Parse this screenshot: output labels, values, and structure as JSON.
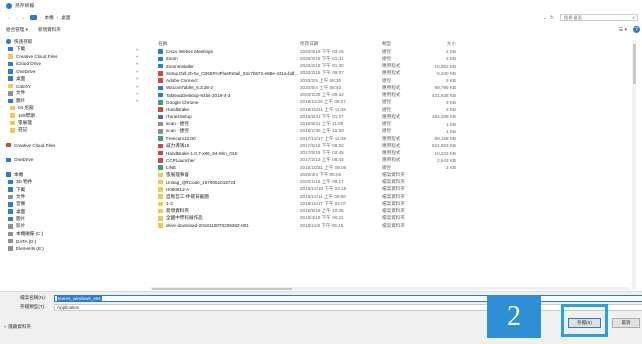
{
  "window": {
    "title": "另存新檔"
  },
  "address": {
    "crumbs": [
      "本機",
      "桌面"
    ],
    "search_placeholder": "搜尋 桌面"
  },
  "toolbar": {
    "organize": "組合管理 ▾",
    "new_folder": "新增資料夾"
  },
  "nav": [
    {
      "label": "快速存取",
      "icon": "star-icon",
      "color": "star",
      "pinned": false
    },
    {
      "label": "下載",
      "icon": "download-icon",
      "color": "blue",
      "pinned": true
    },
    {
      "label": "Creative Cloud Files",
      "icon": "folder-icon",
      "color": "yellow",
      "pinned": true
    },
    {
      "label": "iCloud Drive",
      "icon": "cloud-icon",
      "color": "blue",
      "pinned": true
    },
    {
      "label": "OneDrive",
      "icon": "cloud-icon",
      "color": "blue",
      "pinned": true
    },
    {
      "label": "桌面",
      "icon": "desktop-icon",
      "color": "blue",
      "pinned": true
    },
    {
      "label": "CatchY",
      "icon": "folder-icon",
      "color": "yellow",
      "pinned": true
    },
    {
      "label": "文件",
      "icon": "document-icon",
      "color": "gray",
      "pinned": true
    },
    {
      "label": "圖片",
      "icon": "picture-icon",
      "color": "blue",
      "pinned": true
    },
    {
      "label": "04.尼龍",
      "icon": "folder-icon",
      "color": "yellow",
      "pinned": false
    },
    {
      "label": "109學期",
      "icon": "folder-icon",
      "color": "yellow",
      "pinned": false
    },
    {
      "label": "張展理",
      "icon": "folder-icon",
      "color": "yellow",
      "pinned": false
    },
    {
      "label": "週記",
      "icon": "folder-icon",
      "color": "yellow",
      "pinned": false
    },
    {
      "label": "",
      "icon": "",
      "color": "",
      "pinned": false
    },
    {
      "label": "Creative Cloud Files",
      "icon": "cloud-icon",
      "color": "red",
      "pinned": false
    },
    {
      "label": "",
      "icon": "",
      "color": "",
      "pinned": false
    },
    {
      "label": "OneDrive",
      "icon": "cloud-icon",
      "color": "blue",
      "pinned": false
    },
    {
      "label": "",
      "icon": "",
      "color": "",
      "pinned": false
    },
    {
      "label": "本機",
      "icon": "computer-icon",
      "color": "blue",
      "pinned": false
    },
    {
      "label": "3D 物件",
      "icon": "cube-icon",
      "color": "blue",
      "pinned": false
    },
    {
      "label": "下載",
      "icon": "download-icon",
      "color": "blue",
      "pinned": false
    },
    {
      "label": "文件",
      "icon": "document-icon",
      "color": "gray",
      "pinned": false
    },
    {
      "label": "音樂",
      "icon": "music-icon",
      "color": "blue",
      "pinned": false
    },
    {
      "label": "桌面",
      "icon": "desktop-icon",
      "color": "blue",
      "pinned": false
    },
    {
      "label": "圖片",
      "icon": "picture-icon",
      "color": "blue",
      "pinned": false
    },
    {
      "label": "影片",
      "icon": "video-icon",
      "color": "gray",
      "pinned": false
    },
    {
      "label": "本機磁碟 (C:)",
      "icon": "drive-icon",
      "color": "gray",
      "pinned": false
    },
    {
      "label": "DATA (D:)",
      "icon": "drive-icon",
      "color": "gray",
      "pinned": false
    },
    {
      "label": "Elements (E:)",
      "icon": "drive-icon",
      "color": "gray",
      "pinned": false
    }
  ],
  "columns": [
    "名稱",
    "修改日期",
    "類型",
    "大小"
  ],
  "files": [
    {
      "name": "Cisco Webex Meetings",
      "date": "2020/3/18 下午 03:15",
      "type": "捷徑",
      "size": "2 KB",
      "color": "blue"
    },
    {
      "name": "Zoom",
      "date": "2020/3/18 下午 01:31",
      "type": "捷徑",
      "size": "2 KB",
      "color": "blue"
    },
    {
      "name": "ZoomInstaller",
      "date": "2020/3/18 下午 01:30",
      "type": "應用程式",
      "size": "10,952 KB",
      "color": "blue"
    },
    {
      "name": "Setup.Def.zh-tw_O365ProPlusRetail_04c7b572-e88e-431a-bdf...",
      "date": "2020/2/18 下午 09:07",
      "type": "應用程式",
      "size": "5,340 KB",
      "color": "red"
    },
    {
      "name": "Adobe Connect",
      "date": "2020/2/5 上午 08:30",
      "type": "捷徑",
      "size": "2 KB",
      "color": "red"
    },
    {
      "name": "WacomTablet_6.3.38-2",
      "date": "2020/5/4 上午 08:40",
      "type": "應用程式",
      "size": "99,799 KB",
      "color": "blue"
    },
    {
      "name": "TableauDesktop-64bit-2019-4-3",
      "date": "2020/2/25 上午 09:42",
      "type": "應用程式",
      "size": "421,928 KB",
      "color": "blue"
    },
    {
      "name": "Google Chrome",
      "date": "2019/11/20 上午 09:27",
      "type": "捷徑",
      "size": "3 KB",
      "color": "green"
    },
    {
      "name": "HandBrake",
      "date": "2019/10/21 上午 11:46",
      "type": "捷徑",
      "size": "2 KB",
      "color": "red"
    },
    {
      "name": "iTunesSetup",
      "date": "2019/5/31 下午 01:27",
      "type": "應用程式",
      "size": "282,409 KB",
      "color": "blue"
    },
    {
      "name": "scan - 捷徑",
      "date": "2019/5/31 上午 11:06",
      "type": "捷徑",
      "size": "1 KB",
      "color": "gray"
    },
    {
      "name": "scan - 捷徑",
      "date": "2019/1/30 上午 10:59",
      "type": "捷徑",
      "size": "1 KB",
      "color": "gray"
    },
    {
      "name": "Freecam12.00",
      "date": "2017/12/17 上午 11:48",
      "type": "應用程式",
      "size": "89,168 KB",
      "color": "green"
    },
    {
      "name": "威力導演16",
      "date": "2017/6/16 下午 06:02",
      "type": "應用程式",
      "size": "624,903 KB",
      "color": "red"
    },
    {
      "name": "HandBrake-1.0.7-x86_64-Win_GUI",
      "date": "2017/5/18 下午 02:45",
      "type": "應用程式",
      "size": "10,223 KB",
      "color": "red"
    },
    {
      "name": "CCPLauncher",
      "date": "2017/2/13 上午 08:44",
      "type": "應用程式",
      "size": "2,643 KB",
      "color": "red"
    },
    {
      "name": "LINE",
      "date": "2016/10/21 上午 08:06",
      "type": "捷徑",
      "size": "2 KB",
      "color": "green"
    },
    {
      "name": "張展理事會",
      "date": "2020/3/4 下午 05:00",
      "type": "檔案資料夾",
      "size": "",
      "color": "yellow"
    },
    {
      "name": "Unitag_QRCode_1579051018723",
      "date": "2020/1/15 上午 09:17",
      "type": "檔案資料夾",
      "size": "",
      "color": "yellow"
    },
    {
      "name": "H080812-A",
      "date": "2019/12/18 下午 03:15",
      "type": "檔案資料夾",
      "size": "",
      "color": "yellow"
    },
    {
      "name": "自製互工-件碳背截圖",
      "date": "2019/12/11 上午 09:50",
      "type": "檔案資料夾",
      "size": "",
      "color": "yellow"
    },
    {
      "name": "1-3",
      "date": "2019/10/17 下午 04:07",
      "type": "檔案資料夾",
      "size": "",
      "color": "yellow"
    },
    {
      "name": "新增資料夾",
      "date": "2019/9/15 上午 10:25",
      "type": "檔案資料夾",
      "size": "",
      "color": "yellow"
    },
    {
      "name": "全國中學科展作品",
      "date": "2019/4/18 下午 06:21",
      "type": "檔案資料夾",
      "size": "",
      "color": "yellow"
    },
    {
      "name": "drive-download-20181108T020936Z-001",
      "date": "2018/11/8 下午 05:15",
      "type": "檔案資料夾",
      "size": "",
      "color": "yellow"
    }
  ],
  "bottom": {
    "filename_label": "檔案名稱(N):",
    "filename_value": "teams_windows_x64",
    "filetype_label": "存檔類型(T):",
    "filetype_value": "Application",
    "hide_folders": "隱藏資料夾",
    "save_label": "存檔(S)",
    "cancel_label": "取消"
  },
  "annotation": {
    "step": "2"
  },
  "colors": {
    "accent": "#2a7bd4",
    "badge": "#2d8fd5",
    "highlight": "#29a3e0"
  }
}
